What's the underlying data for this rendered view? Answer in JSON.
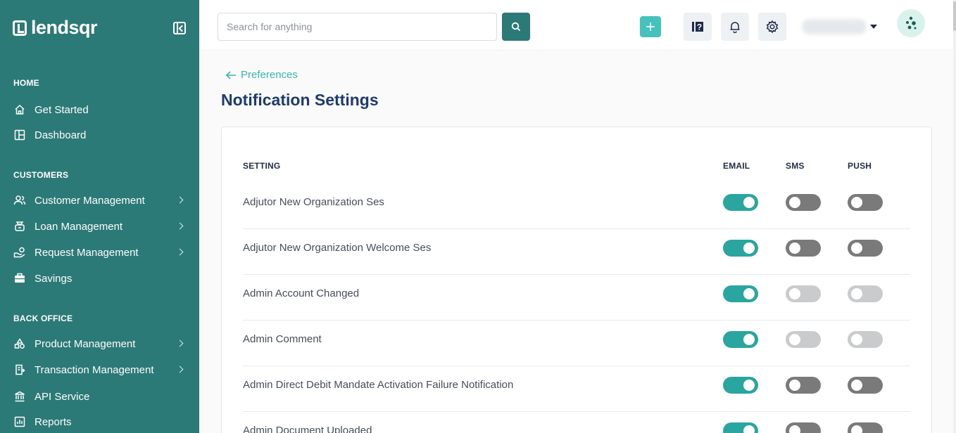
{
  "app": {
    "brand": "lendsqr"
  },
  "sidebar": {
    "sections": [
      {
        "title": "HOME",
        "items": [
          {
            "label": "Get Started",
            "icon": "home-icon",
            "chevron": false
          },
          {
            "label": "Dashboard",
            "icon": "dashboard-icon",
            "chevron": false
          }
        ]
      },
      {
        "title": "CUSTOMERS",
        "items": [
          {
            "label": "Customer Management",
            "icon": "users-icon",
            "chevron": true
          },
          {
            "label": "Loan Management",
            "icon": "loan-icon",
            "chevron": true
          },
          {
            "label": "Request Management",
            "icon": "request-icon",
            "chevron": true
          },
          {
            "label": "Savings",
            "icon": "briefcase-icon",
            "chevron": false
          }
        ]
      },
      {
        "title": "BACK OFFICE",
        "items": [
          {
            "label": "Product Management",
            "icon": "product-icon",
            "chevron": true
          },
          {
            "label": "Transaction Management",
            "icon": "transaction-icon",
            "chevron": true
          },
          {
            "label": "API Service",
            "icon": "bank-icon",
            "chevron": false
          },
          {
            "label": "Reports",
            "icon": "reports-icon",
            "chevron": false
          }
        ]
      }
    ]
  },
  "topbar": {
    "search": {
      "placeholder": "Search for anything",
      "value": ""
    },
    "accent": "#2c7a78"
  },
  "page": {
    "back_label": "Preferences",
    "title": "Notification Settings",
    "columns": {
      "setting": "SETTING",
      "email": "EMAIL",
      "sms": "SMS",
      "push": "PUSH"
    },
    "rows": [
      {
        "label": "Adjutor New Organization Ses",
        "email": "on",
        "sms": "off",
        "push": "off"
      },
      {
        "label": "Adjutor New Organization Welcome Ses",
        "email": "on",
        "sms": "off",
        "push": "off"
      },
      {
        "label": "Admin Account Changed",
        "email": "on",
        "sms": "disabled",
        "push": "disabled"
      },
      {
        "label": "Admin Comment",
        "email": "on",
        "sms": "disabled",
        "push": "disabled"
      },
      {
        "label": "Admin Direct Debit Mandate Activation Failure Notification",
        "email": "on",
        "sms": "off",
        "push": "off"
      },
      {
        "label": "Admin Document Uploaded",
        "email": "on",
        "sms": "off",
        "push": "off"
      }
    ]
  }
}
